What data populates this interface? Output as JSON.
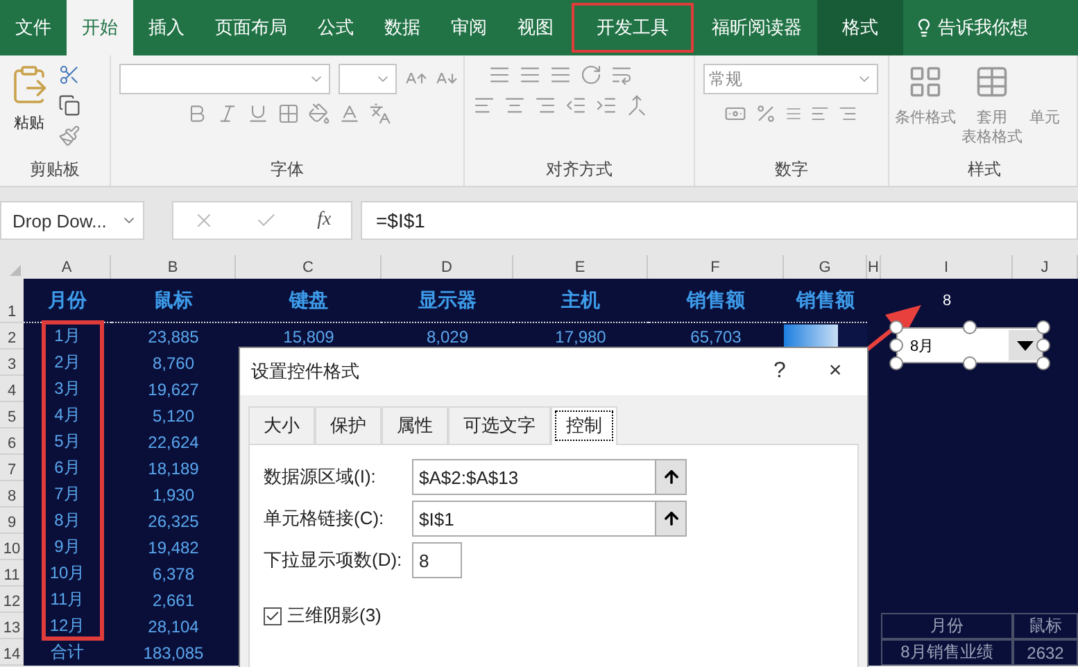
{
  "ribbon_tabs": [
    {
      "label": "文件",
      "selected": false,
      "outlined": false,
      "contextual": false
    },
    {
      "label": "开始",
      "selected": true,
      "outlined": false,
      "contextual": false
    },
    {
      "label": "插入",
      "selected": false,
      "outlined": false,
      "contextual": false
    },
    {
      "label": "页面布局",
      "selected": false,
      "outlined": false,
      "contextual": false
    },
    {
      "label": "公式",
      "selected": false,
      "outlined": false,
      "contextual": false
    },
    {
      "label": "数据",
      "selected": false,
      "outlined": false,
      "contextual": false
    },
    {
      "label": "审阅",
      "selected": false,
      "outlined": false,
      "contextual": false
    },
    {
      "label": "视图",
      "selected": false,
      "outlined": false,
      "contextual": false
    },
    {
      "label": "开发工具",
      "selected": false,
      "outlined": true,
      "contextual": false
    },
    {
      "label": "福昕阅读器",
      "selected": false,
      "outlined": false,
      "contextual": false
    },
    {
      "label": "格式",
      "selected": false,
      "outlined": false,
      "contextual": true
    }
  ],
  "tell_me": "告诉我你想",
  "ribbon": {
    "paste": "粘贴",
    "number_format": "常规",
    "conditional_format": "条件格式",
    "table_format": [
      "套用",
      "表格格式"
    ],
    "cell_styles": "单元",
    "groups": [
      "剪贴板",
      "字体",
      "对齐方式",
      "数字",
      "样式"
    ]
  },
  "formula_bar": {
    "name_box": "Drop Dow...",
    "function_label": "fx",
    "formula": "=$I$1"
  },
  "sheet": {
    "columns": [
      "A",
      "B",
      "C",
      "D",
      "E",
      "F",
      "G",
      "H",
      "I",
      "J"
    ],
    "rows": [
      {
        "number": "1",
        "kind": "header",
        "cells": {
          "A": "月份",
          "B": "鼠标",
          "C": "键盘",
          "D": "显示器",
          "E": "主机",
          "F": "销售额",
          "G": "销售额",
          "I": {
            "text": "8",
            "kind": "plain"
          }
        }
      },
      {
        "number": "2",
        "kind": "data",
        "cells": {
          "A": "1月",
          "B": "23,885",
          "C": "15,809",
          "D": "8,029",
          "E": "17,980",
          "F": "65,703",
          "G": {
            "kind": "databar",
            "level": 0.65
          }
        }
      },
      {
        "number": "3",
        "kind": "data",
        "cells": {
          "A": "2月",
          "B": "8,760"
        }
      },
      {
        "number": "4",
        "kind": "data",
        "cells": {
          "A": "3月",
          "B": "19,627"
        }
      },
      {
        "number": "5",
        "kind": "data",
        "cells": {
          "A": "4月",
          "B": "5,120"
        }
      },
      {
        "number": "6",
        "kind": "data",
        "cells": {
          "A": "5月",
          "B": "22,624"
        }
      },
      {
        "number": "7",
        "kind": "data",
        "cells": {
          "A": "6月",
          "B": "18,189"
        }
      },
      {
        "number": "8",
        "kind": "data",
        "cells": {
          "A": "7月",
          "B": "1,930"
        }
      },
      {
        "number": "9",
        "kind": "data",
        "cells": {
          "A": "8月",
          "B": "26,325"
        }
      },
      {
        "number": "10",
        "kind": "data",
        "cells": {
          "A": "9月",
          "B": "19,482"
        }
      },
      {
        "number": "11",
        "kind": "data",
        "cells": {
          "A": "10月",
          "B": "6,378"
        }
      },
      {
        "number": "12",
        "kind": "data",
        "cells": {
          "A": "11月",
          "B": "2,661"
        }
      },
      {
        "number": "13",
        "kind": "data",
        "cells": {
          "A": "12月",
          "B": "28,104",
          "I": {
            "text": "月份",
            "kind": "table"
          },
          "J": {
            "text": "鼠标",
            "kind": "table"
          }
        }
      },
      {
        "number": "14",
        "kind": "total",
        "cells": {
          "A": "合计",
          "B": "183,085",
          "I": {
            "text": "8月销售业绩",
            "kind": "table"
          },
          "J": {
            "text": "2632",
            "kind": "table"
          }
        }
      }
    ]
  },
  "dropdown_control": {
    "value": "8月"
  },
  "dialog": {
    "title": "设置控件格式",
    "help": "?",
    "close": "×",
    "tabs": [
      {
        "label": "大小",
        "selected": false
      },
      {
        "label": "保护",
        "selected": false
      },
      {
        "label": "属性",
        "selected": false
      },
      {
        "label": "可选文字",
        "selected": false
      },
      {
        "label": "控制",
        "selected": true
      }
    ],
    "fields": [
      {
        "label": "数据源区域(I):",
        "value": "$A$2:$A$13",
        "kind": "range"
      },
      {
        "label": "单元格链接(C):",
        "value": "$I$1",
        "kind": "range"
      },
      {
        "label": "下拉显示项数(D):",
        "value": "8",
        "kind": "number"
      }
    ],
    "shading": {
      "label": "三维阴影(3)",
      "checked": true
    }
  }
}
